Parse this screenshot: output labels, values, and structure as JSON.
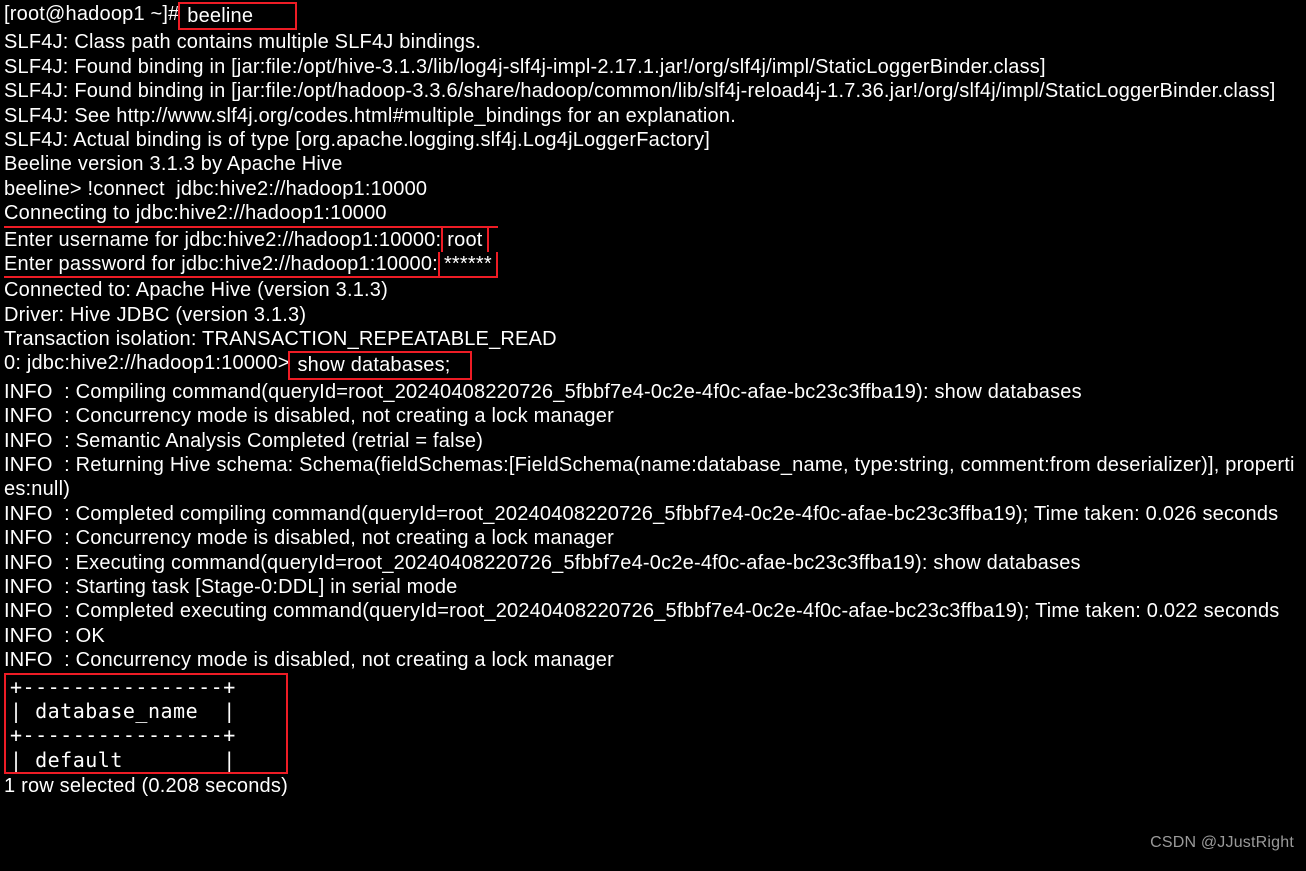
{
  "prompt": {
    "shell_prefix": "[root@hadoop1 ~]#",
    "command": " beeline       "
  },
  "slf4j": {
    "l1": "SLF4J: Class path contains multiple SLF4J bindings.",
    "l2": "SLF4J: Found binding in [jar:file:/opt/hive-3.1.3/lib/log4j-slf4j-impl-2.17.1.jar!/org/slf4j/impl/StaticLoggerBinder.class]",
    "l3": "SLF4J: Found binding in [jar:file:/opt/hadoop-3.3.6/share/hadoop/common/lib/slf4j-reload4j-1.7.36.jar!/org/slf4j/impl/StaticLoggerBinder.class]",
    "l4": "SLF4J: See http://www.slf4j.org/codes.html#multiple_bindings for an explanation.",
    "l5": "SLF4J: Actual binding is of type [org.apache.logging.slf4j.Log4jLoggerFactory]"
  },
  "beeline": {
    "version": "Beeline version 3.1.3 by Apache Hive",
    "connect_cmd": "beeline> !connect  jdbc:hive2://hadoop1:10000",
    "connecting": "Connecting to jdbc:hive2://hadoop1:10000",
    "user_prompt": "Enter username for jdbc:hive2://hadoop1:10000:",
    "user_value": " root      ",
    "pass_prompt": "Enter password for jdbc:hive2://hadoop1:10000:",
    "pass_value": " ******   ",
    "connected": "Connected to: Apache Hive (version 3.1.3)",
    "driver": "Driver: Hive JDBC (version 3.1.3)",
    "isolation": "Transaction isolation: TRANSACTION_REPEATABLE_READ",
    "sql_prompt": "0: jdbc:hive2://hadoop1:10000>",
    "sql_cmd": " show databases;   "
  },
  "info": {
    "l1": "INFO  : Compiling command(queryId=root_20240408220726_5fbbf7e4-0c2e-4f0c-afae-bc23c3ffba19): show databases",
    "l2": "INFO  : Concurrency mode is disabled, not creating a lock manager",
    "l3": "INFO  : Semantic Analysis Completed (retrial = false)",
    "l4": "INFO  : Returning Hive schema: Schema(fieldSchemas:[FieldSchema(name:database_name, type:string, comment:from deserializer)], properties:null)",
    "l5": "INFO  : Completed compiling command(queryId=root_20240408220726_5fbbf7e4-0c2e-4f0c-afae-bc23c3ffba19); Time taken: 0.026 seconds",
    "l6": "INFO  : Concurrency mode is disabled, not creating a lock manager",
    "l7": "INFO  : Executing command(queryId=root_20240408220726_5fbbf7e4-0c2e-4f0c-afae-bc23c3ffba19): show databases",
    "l8": "INFO  : Starting task [Stage-0:DDL] in serial mode",
    "l9": "INFO  : Completed executing command(queryId=root_20240408220726_5fbbf7e4-0c2e-4f0c-afae-bc23c3ffba19); Time taken: 0.022 seconds",
    "l10": "INFO  : OK",
    "l11": "INFO  : Concurrency mode is disabled, not creating a lock manager"
  },
  "result": {
    "border_top": "+----------------+",
    "header": "| database_name  |",
    "border_mid": "+----------------+",
    "row": "| default        |",
    "border_bot_partial": "+----------------+"
  },
  "footer": {
    "summary": "1 row selected (0.208 seconds)"
  },
  "watermark": "CSDN @JJustRight"
}
